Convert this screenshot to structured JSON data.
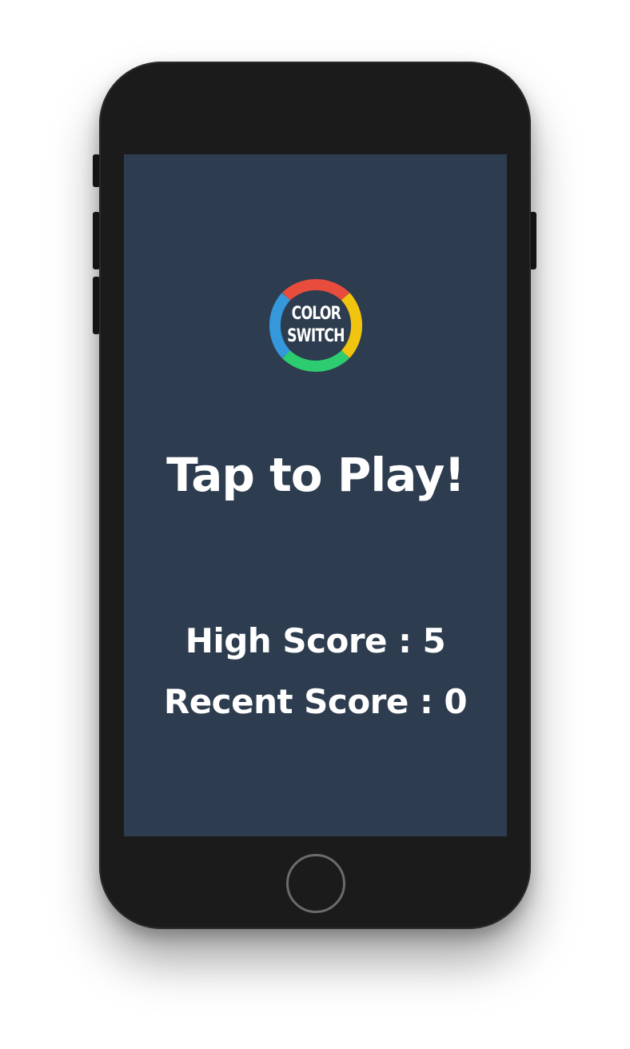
{
  "logo": {
    "line1": "COLOR",
    "line2": "SWITCH",
    "ring_colors": [
      "#e74c3c",
      "#f1c40f",
      "#2ecc71",
      "#3498db"
    ]
  },
  "screen": {
    "background": "#2d3c4e",
    "prompt": "Tap to Play!",
    "high_score": "High Score : 5",
    "recent_score": "Recent Score : 0"
  },
  "device": {
    "home_button": "home-button"
  }
}
